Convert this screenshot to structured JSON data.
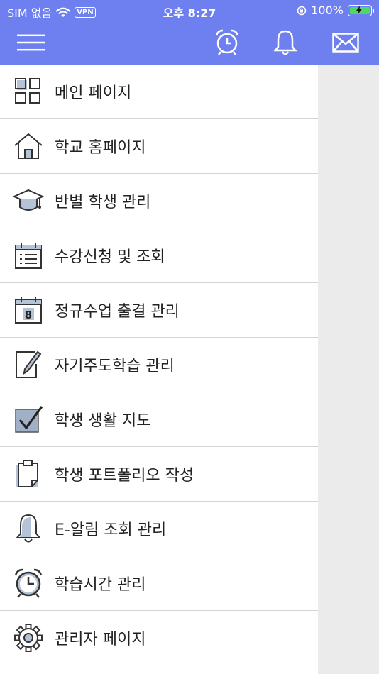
{
  "status": {
    "carrier": "SIM 없음",
    "vpn": "VPN",
    "time": "오후 8:27",
    "battery": "100%"
  },
  "toolbar": {
    "icons": [
      "hamburger-menu-icon",
      "alarm-clock-icon",
      "bell-icon",
      "envelope-icon"
    ]
  },
  "menu": {
    "items": [
      {
        "label": "메인 페이지",
        "icon": "grid-icon"
      },
      {
        "label": "학교 홈페이지",
        "icon": "house-icon"
      },
      {
        "label": "반별 학생 관리",
        "icon": "graduation-cap-icon"
      },
      {
        "label": "수강신청 및 조회",
        "icon": "calendar-list-icon"
      },
      {
        "label": "정규수업 출결 관리",
        "icon": "calendar-8-icon"
      },
      {
        "label": "자기주도학습 관리",
        "icon": "pencil-note-icon"
      },
      {
        "label": "학생 생활 지도",
        "icon": "checkbox-icon"
      },
      {
        "label": "학생 포트폴리오 작성",
        "icon": "clipboard-icon"
      },
      {
        "label": "E-알림 조회 관리",
        "icon": "bell-icon"
      },
      {
        "label": "학습시간 관리",
        "icon": "alarm-clock-icon"
      },
      {
        "label": "관리자 페이지",
        "icon": "gear-icon"
      }
    ]
  },
  "colors": {
    "header": "#6e7ff0",
    "sidebar_bg": "#ffffff",
    "backdrop": "#ebebeb",
    "divider": "#d4d4d4",
    "battery_charge": "#4cd964"
  }
}
